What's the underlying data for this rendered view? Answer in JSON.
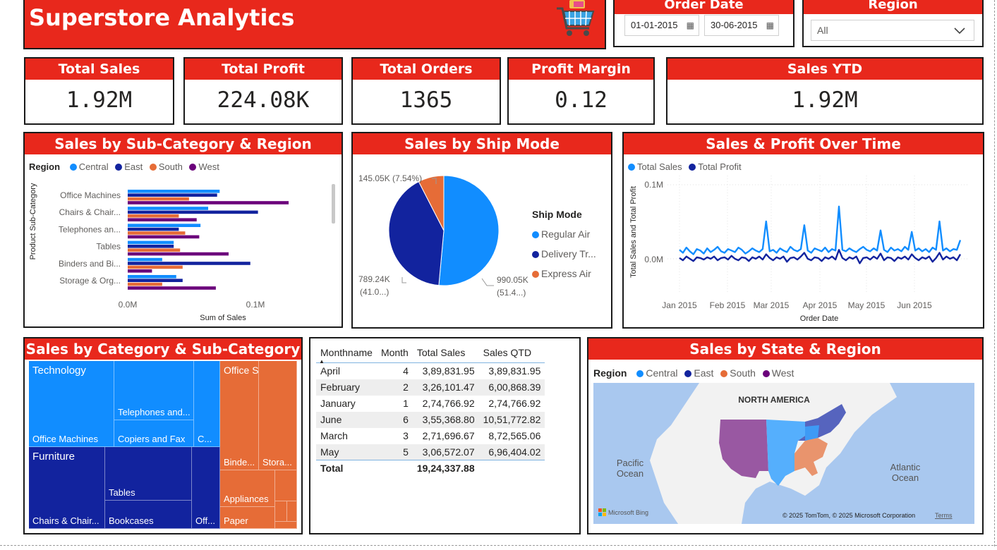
{
  "header": {
    "title": "Superstore Analytics",
    "cart_icon": "shopping-cart-icon"
  },
  "order_date": {
    "label": "Order Date",
    "start": "01-01-2015",
    "end": "30-06-2015"
  },
  "region_filter": {
    "label": "Region",
    "value": "All"
  },
  "kpis": [
    {
      "label": "Total Sales",
      "value": "1.92M"
    },
    {
      "label": "Total Profit",
      "value": "224.08K"
    },
    {
      "label": "Total Orders",
      "value": "1365"
    },
    {
      "label": "Profit Margin",
      "value": "0.12"
    },
    {
      "label": "Sales YTD",
      "value": "1.92M"
    }
  ],
  "colors": {
    "accent": "#e8281c",
    "central": "#118dff",
    "east": "#12239e",
    "south": "#e66c37",
    "west": "#6b007b"
  },
  "bar_chart": {
    "title": "Sales by Sub-Category & Region",
    "legend_title": "Region",
    "legend": [
      "Central",
      "East",
      "South",
      "West"
    ],
    "ylabel": "Product Sub-Category",
    "xlabel": "Sum of Sales",
    "xticks": [
      "0.0M",
      "0.1M"
    ]
  },
  "pie_chart": {
    "title": "Sales by Ship Mode",
    "legend_title": "Ship Mode",
    "legend": [
      "Regular Air",
      "Delivery Tr...",
      "Express Air"
    ],
    "labels": {
      "express_a": "145.05K (7.54%)",
      "delivery_a": "789.24K",
      "delivery_b": "(41.0...)",
      "regular_a": "990.05K",
      "regular_b": "(51.4...)"
    }
  },
  "line_chart": {
    "title": "Sales & Profit Over Time",
    "legend": [
      "Total Sales",
      "Total Profit"
    ],
    "ylabel": "Total Sales and Total Profit",
    "xlabel": "Order Date",
    "yticks": [
      "0.1M",
      "0.0M"
    ],
    "xticks": [
      "Jan 2015",
      "Feb 2015",
      "Mar 2015",
      "Apr 2015",
      "May 2015",
      "Jun 2015"
    ]
  },
  "treemap": {
    "title": "Sales by Category & Sub-Category",
    "categories": [
      "Technology",
      "Furniture",
      "Office Supplies"
    ],
    "labels": {
      "office_machines": "Office Machines",
      "telephones": "Telephones and...",
      "copiers": "Copiers and Fax",
      "tech_other": "C...",
      "chairs": "Chairs & Chair...",
      "tables": "Tables",
      "bookcases": "Bookcases",
      "furn_other": "Off...",
      "binders": "Binde...",
      "storage": "Stora...",
      "appliances": "Appliances",
      "paper": "Paper"
    }
  },
  "table": {
    "columns": [
      "Monthname",
      "Month",
      "Total Sales",
      "Sales QTD"
    ],
    "rows": [
      [
        "April",
        "4",
        "3,89,831.95",
        "3,89,831.95"
      ],
      [
        "February",
        "2",
        "3,26,101.47",
        "6,00,868.39"
      ],
      [
        "January",
        "1",
        "2,74,766.92",
        "2,74,766.92"
      ],
      [
        "June",
        "6",
        "3,55,368.80",
        "10,51,772.82"
      ],
      [
        "March",
        "3",
        "2,71,696.67",
        "8,72,565.06"
      ],
      [
        "May",
        "5",
        "3,06,572.07",
        "6,96,404.02"
      ]
    ],
    "total": [
      "Total",
      "",
      "19,24,337.88",
      ""
    ]
  },
  "map": {
    "title": "Sales by State & Region",
    "legend_title": "Region",
    "legend": [
      "Central",
      "East",
      "South",
      "West"
    ],
    "labels": {
      "continent": "NORTH AMERICA",
      "pacific": "Pacific",
      "pacific2": "Ocean",
      "atlantic": "Atlantic",
      "atlantic2": "Ocean",
      "brand": "Microsoft Bing",
      "copyright": "© 2025 TomTom, © 2025 Microsoft Corporation",
      "terms": "Terms"
    }
  },
  "chart_data": [
    {
      "type": "bar",
      "title": "Sales by Sub-Category & Region",
      "xlabel": "Sum of Sales",
      "ylabel": "Product Sub-Category",
      "xlim": [
        0,
        0.15
      ],
      "categories": [
        "Office Machines",
        "Chairs & Chair...",
        "Telephones an...",
        "Tables",
        "Binders and Bi...",
        "Storage & Org..."
      ],
      "series": [
        {
          "name": "Central",
          "values": [
            0.072,
            0.063,
            0.057,
            0.036,
            0.027,
            0.038
          ]
        },
        {
          "name": "East",
          "values": [
            0.07,
            0.102,
            0.04,
            0.036,
            0.096,
            0.043
          ]
        },
        {
          "name": "South",
          "values": [
            0.048,
            0.04,
            0.045,
            0.041,
            0.043,
            0.027
          ]
        },
        {
          "name": "West",
          "values": [
            0.126,
            0.054,
            0.056,
            0.079,
            0.019,
            0.069
          ]
        }
      ]
    },
    {
      "type": "pie",
      "title": "Sales by Ship Mode",
      "categories": [
        "Regular Air",
        "Delivery Truck",
        "Express Air"
      ],
      "values": [
        990.05,
        789.24,
        145.05
      ],
      "percent": [
        51.4,
        41.0,
        7.54
      ]
    },
    {
      "type": "line",
      "title": "Sales & Profit Over Time",
      "xlabel": "Order Date",
      "ylabel": "Total Sales and Total Profit",
      "x": [
        "2015-01-01",
        "2015-06-30"
      ],
      "series": [
        {
          "name": "Total Sales",
          "values": [
            0.012,
            0.008,
            0.015,
            0.01,
            0.006,
            0.013,
            0.011,
            0.007,
            0.014,
            0.009,
            0.012,
            0.016,
            0.01,
            0.008,
            0.013,
            0.011,
            0.009,
            0.015,
            0.012,
            0.007,
            0.01,
            0.014,
            0.011,
            0.009,
            0.013,
            0.05,
            0.01,
            0.012,
            0.008,
            0.014,
            0.011,
            0.009,
            0.016,
            0.012,
            0.01,
            0.013,
            0.045,
            0.011,
            0.008,
            0.014,
            0.012,
            0.01,
            0.015,
            0.009,
            0.013,
            0.011,
            0.07,
            0.012,
            0.01,
            0.014,
            0.011,
            0.009,
            0.013,
            0.016,
            0.012,
            0.01,
            0.014,
            0.011,
            0.038,
            0.012,
            0.009,
            0.015,
            0.011,
            0.013,
            0.01,
            0.016,
            0.012,
            0.036,
            0.011,
            0.014,
            0.01,
            0.013,
            0.009,
            0.015,
            0.012,
            0.05,
            0.011,
            0.014,
            0.01,
            0.013,
            0.012,
            0.025
          ]
        },
        {
          "name": "Total Profit",
          "values": [
            0.001,
            -0.002,
            0.003,
            0.0,
            -0.003,
            0.002,
            0.001,
            -0.001,
            0.002,
            0.0,
            0.003,
            -0.002,
            0.001,
            0.002,
            -0.001,
            0.004,
            0.0,
            -0.002,
            0.002,
            0.001,
            -0.003,
            0.002,
            0.0,
            0.003,
            -0.001,
            0.006,
            0.001,
            -0.002,
            0.002,
            0.0,
            0.003,
            -0.004,
            0.001,
            0.002,
            -0.001,
            0.003,
            0.008,
            0.0,
            -0.002,
            0.002,
            0.001,
            -0.003,
            0.002,
            0.0,
            0.003,
            -0.001,
            0.012,
            0.001,
            -0.002,
            0.002,
            0.0,
            0.003,
            -0.006,
            0.001,
            0.002,
            -0.001,
            0.003,
            0.0,
            0.007,
            -0.002,
            0.002,
            0.001,
            -0.003,
            0.002,
            0.0,
            0.003,
            -0.001,
            0.006,
            0.001,
            -0.002,
            0.002,
            0.0,
            0.003,
            -0.004,
            0.001,
            0.008,
            -0.001,
            0.003,
            0.0,
            0.002,
            -0.002,
            0.006
          ]
        }
      ]
    },
    {
      "type": "table",
      "columns": [
        "Monthname",
        "Month",
        "Total Sales",
        "Sales QTD"
      ],
      "rows": [
        [
          "April",
          4,
          389831.95,
          389831.95
        ],
        [
          "February",
          2,
          326101.47,
          600868.39
        ],
        [
          "January",
          1,
          274766.92,
          274766.92
        ],
        [
          "June",
          6,
          355368.8,
          1051772.82
        ],
        [
          "March",
          3,
          271696.67,
          872565.06
        ],
        [
          "May",
          5,
          306572.07,
          696404.02
        ]
      ],
      "total": 1924337.88
    }
  ]
}
